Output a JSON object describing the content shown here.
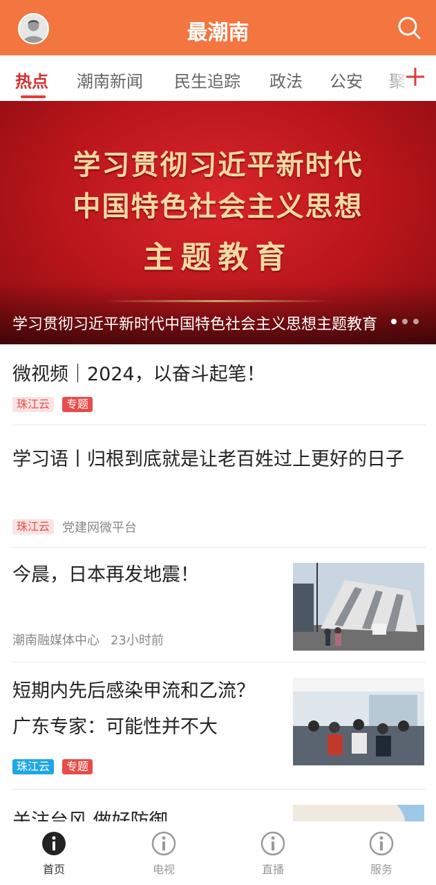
{
  "header": {
    "title": "最潮南",
    "avatar_icon": "user-avatar-icon",
    "search_icon": "search-icon"
  },
  "tabs": [
    {
      "label": "热点",
      "active": true
    },
    {
      "label": "潮南新闻",
      "active": false
    },
    {
      "label": "民生追踪",
      "active": false
    },
    {
      "label": "政法",
      "active": false
    },
    {
      "label": "公安",
      "active": false
    },
    {
      "label": "聚",
      "active": false
    }
  ],
  "add_tab_icon": "plus-icon",
  "banner": {
    "line1": "学习贯彻习近平新时代",
    "line2": "中国特色社会主义思想",
    "line3": "主题教育",
    "caption": "学习贯彻习近平新时代中国特色社会主义思想主题教育",
    "dots": 3,
    "active_dot": 0
  },
  "feed": [
    {
      "title": "微视频｜2024，以奋斗起笔！",
      "tags": [
        "珠江云",
        "专题"
      ]
    },
    {
      "title": "学习语丨归根到底就是让老百姓过上更好的日子",
      "tags": [
        "珠江云"
      ],
      "source": "党建网微平台"
    },
    {
      "title": "今晨，日本再发地震！",
      "source": "潮南融媒体中心",
      "time": "23小时前",
      "image": "earthquake-photo"
    },
    {
      "title": "短期内先后感染甲流和乙流？广东专家：可能性并不大",
      "tags": [
        "珠江云",
        "专题"
      ],
      "image": "hospital-photo"
    },
    {
      "title": "关注台风 做好防御",
      "image": "map-photo"
    }
  ],
  "tabbar": [
    {
      "label": "首页",
      "icon": "info-icon",
      "active": true
    },
    {
      "label": "电视",
      "icon": "info-icon",
      "active": false
    },
    {
      "label": "直播",
      "icon": "info-icon",
      "active": false
    },
    {
      "label": "服务",
      "icon": "info-icon",
      "active": false
    }
  ],
  "colors": {
    "header_bg": "#f3753f",
    "accent_red": "#d42f2f",
    "tag_blue": "#1ea7e6"
  }
}
